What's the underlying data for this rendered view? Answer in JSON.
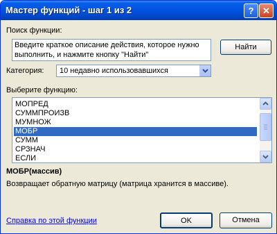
{
  "window": {
    "title": "Мастер функций - шаг 1 из 2",
    "help_glyph": "?",
    "close_glyph": "✕"
  },
  "search": {
    "label": "Поиск функции:",
    "text_line1": "Введите краткое описание действия, которое нужно",
    "text_line2": "выполнить, и нажмите кнопку \"Найти\"",
    "find_button": "Найти"
  },
  "category": {
    "label": "Категория:",
    "value": "10 недавно использовавшихся"
  },
  "functions": {
    "label": "Выберите функцию:",
    "items": [
      "МОПРЕД",
      "СУММПРОИЗВ",
      "МУМНОЖ",
      "МОБР",
      "СУММ",
      "СРЗНАЧ",
      "ЕСЛИ"
    ],
    "selected_index": 3
  },
  "description": {
    "signature": "МОБР(массив)",
    "text": "Возвращает обратную матрицу (матрица хранится в массиве)."
  },
  "footer": {
    "help_link": "Справка по этой функции",
    "ok": "OK",
    "cancel": "Отмена"
  },
  "colors": {
    "titlebar": "#0054e3",
    "selection": "#316ac5",
    "link": "#0000ff",
    "face": "#ece9d8"
  }
}
